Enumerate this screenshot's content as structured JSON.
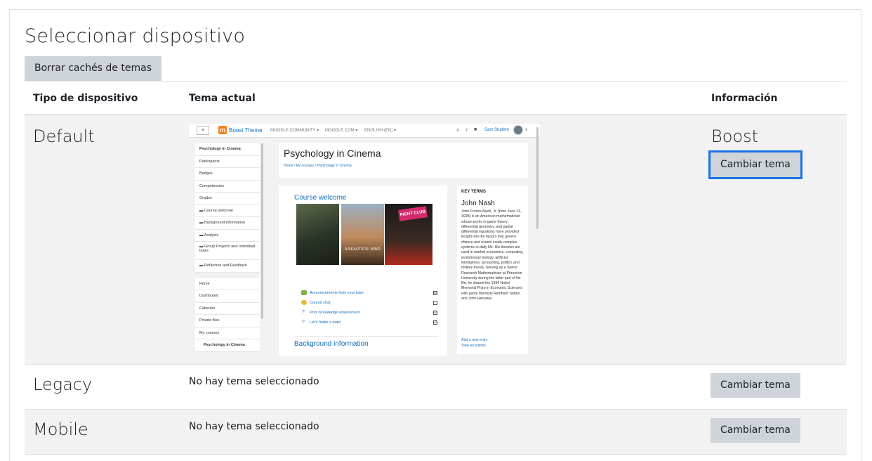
{
  "page": {
    "title": "Seleccionar dispositivo",
    "purge_button": "Borrar cachés de temas"
  },
  "table": {
    "headers": [
      "Tipo de dispositivo",
      "Tema actual",
      "Información"
    ],
    "rows": [
      {
        "device": "Default",
        "theme": "Boost",
        "action": "Cambiar tema"
      },
      {
        "device": "Legacy",
        "current": "No hay tema seleccionado",
        "action": "Cambiar tema"
      },
      {
        "device": "Mobile",
        "current": "No hay tema seleccionado",
        "action": "Cambiar tema"
      }
    ]
  },
  "preview": {
    "brand": "Boost Theme",
    "nav_links": [
      "MOODLE COMMUNITY ▾",
      "MOODLE.COM ▾",
      "ENGLISH (EN) ▾"
    ],
    "user": "Sam Student",
    "course_title": "Psychology in Cinema",
    "breadcrumb": "Home / My courses / Psychology in Cinema",
    "drawer_top": [
      "Psychology in Cinema",
      "Participants",
      "Badges",
      "Competencies",
      "Grades",
      "Course welcome",
      "Background information",
      "Analysis",
      "Group Projects and Individual tasks",
      "Reflection and Feedback"
    ],
    "drawer_bottom": [
      "Home",
      "Dashboard",
      "Calendar",
      "Private files",
      "My courses",
      "Psychology in Cinema"
    ],
    "section1": "Course welcome",
    "activities": [
      "Announcements from your tutor",
      "Course chat",
      "Prior Knowledge assessment",
      "Let's make a date!"
    ],
    "checks": [
      "☑",
      "",
      "☑",
      "☑"
    ],
    "section2": "Background information",
    "poster2_text": "A BEAUTIFUL MIND",
    "poster3_text": "FIGHT CLUB",
    "block_title": "KEY TERMS",
    "term": "John Nash",
    "term_desc": "John Forbes Nash, Jr. (born June 13, 1928) is an American mathematician whose works in game theory, differential geometry, and partial differential equations have provided insight into the factors that govern chance and events inside complex systems in daily life. His theories are used in market economics, computing, evolutionary biology, artificial intelligence, accounting, politics and military theory. Serving as a Senior Research Mathematician at Princeton University during the latter part of his life, he shared the 1994 Nobel Memorial Prize in Economic Sciences with game theorists Reinhard Selten and John Harsanyi.",
    "add_entry": "Add a new entry",
    "view_all": "View all entries"
  },
  "colors": {
    "button_bg": "#ced4da",
    "focus_ring": "#1a73e8",
    "shaded_row": "#f2f2f2",
    "link": "#0f6cbf",
    "moodle_orange": "#f98012"
  }
}
